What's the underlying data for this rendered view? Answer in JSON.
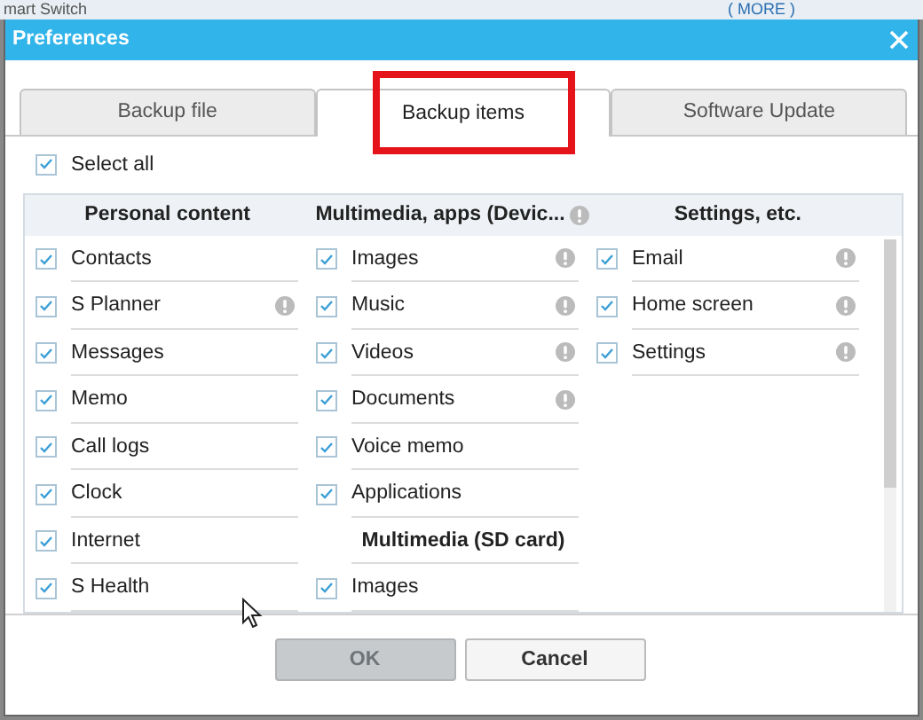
{
  "background_app": {
    "title": "mart Switch",
    "more_button": "( MORE )"
  },
  "window": {
    "title": "Preferences"
  },
  "tabs": [
    {
      "label": "Backup file",
      "selected": false,
      "highlighted": false
    },
    {
      "label": "Backup items",
      "selected": true,
      "highlighted": true
    },
    {
      "label": "Software Update",
      "selected": false,
      "highlighted": false
    }
  ],
  "select_all": {
    "label": "Select all",
    "checked": true
  },
  "columns": [
    {
      "heading": "Personal content",
      "info": false,
      "items": [
        {
          "kind": "item",
          "label": "Contacts",
          "checked": true,
          "info": false
        },
        {
          "kind": "item",
          "label": "S Planner",
          "checked": true,
          "info": true
        },
        {
          "kind": "item",
          "label": "Messages",
          "checked": true,
          "info": false
        },
        {
          "kind": "item",
          "label": "Memo",
          "checked": true,
          "info": false
        },
        {
          "kind": "item",
          "label": "Call logs",
          "checked": true,
          "info": false
        },
        {
          "kind": "item",
          "label": "Clock",
          "checked": true,
          "info": false
        },
        {
          "kind": "item",
          "label": "Internet",
          "checked": true,
          "info": false
        },
        {
          "kind": "item",
          "label": "S Health",
          "checked": true,
          "info": false
        }
      ]
    },
    {
      "heading": "Multimedia, apps (Devic...",
      "info": true,
      "items": [
        {
          "kind": "item",
          "label": "Images",
          "checked": true,
          "info": true
        },
        {
          "kind": "item",
          "label": "Music",
          "checked": true,
          "info": true
        },
        {
          "kind": "item",
          "label": "Videos",
          "checked": true,
          "info": true
        },
        {
          "kind": "item",
          "label": "Documents",
          "checked": true,
          "info": true
        },
        {
          "kind": "item",
          "label": "Voice memo",
          "checked": true,
          "info": false
        },
        {
          "kind": "item",
          "label": "Applications",
          "checked": true,
          "info": false
        },
        {
          "kind": "heading",
          "label": "Multimedia (SD card)"
        },
        {
          "kind": "item",
          "label": "Images",
          "checked": true,
          "info": false
        }
      ]
    },
    {
      "heading": "Settings, etc.",
      "info": false,
      "items": [
        {
          "kind": "item",
          "label": "Email",
          "checked": true,
          "info": true
        },
        {
          "kind": "item",
          "label": "Home screen",
          "checked": true,
          "info": true
        },
        {
          "kind": "item",
          "label": "Settings",
          "checked": true,
          "info": true
        }
      ]
    }
  ],
  "buttons": [
    {
      "label": "OK",
      "disabled": true
    },
    {
      "label": "Cancel",
      "disabled": false
    }
  ]
}
